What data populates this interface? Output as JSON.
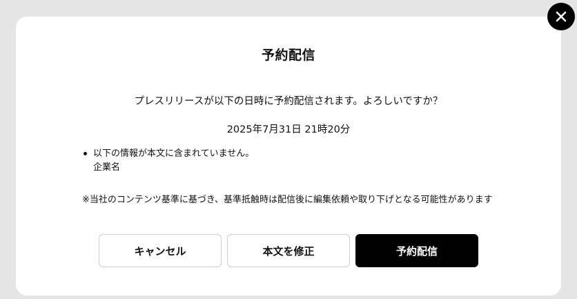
{
  "dialog": {
    "title": "予約配信",
    "message": "プレスリリースが以下の日時に予約配信されます。よろしいですか？",
    "scheduled_datetime": "2025年7月31日 21時20分",
    "warnings": [
      {
        "text": "以下の情報が本文に含まれていません。",
        "detail": "企業名"
      }
    ],
    "notice": "※当社のコンテンツ基準に基づき、基準抵触時は配信後に編集依頼や取り下げとなる可能性があります",
    "buttons": {
      "cancel": "キャンセル",
      "edit": "本文を修正",
      "schedule": "予約配信"
    },
    "close_icon": "close-icon"
  },
  "colors": {
    "backdrop": "#e5e5e5",
    "modal_bg": "#ffffff",
    "primary_button": "#000000",
    "outline_border": "#cfcfcf"
  }
}
